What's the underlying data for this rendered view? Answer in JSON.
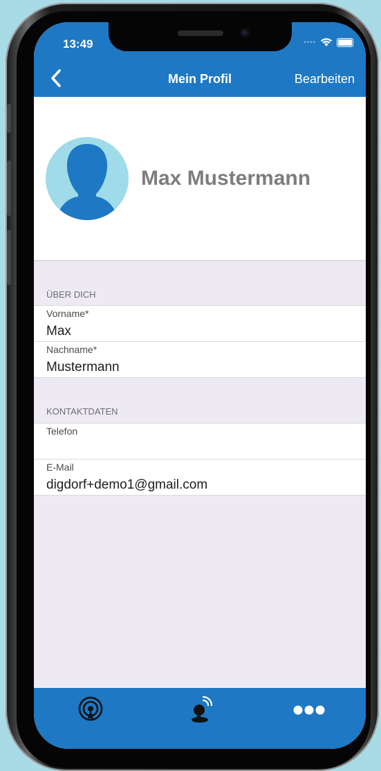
{
  "status_bar": {
    "time": "13:49"
  },
  "nav": {
    "title": "Mein Profil",
    "edit_label": "Bearbeiten"
  },
  "profile": {
    "name": "Max Mustermann"
  },
  "sections": [
    {
      "header": "ÜBER DICH",
      "fields": [
        {
          "label": "Vorname*",
          "value": "Max"
        },
        {
          "label": "Nachname*",
          "value": "Mustermann"
        }
      ]
    },
    {
      "header": "KONTAKTDATEN",
      "fields": [
        {
          "label": "Telefon",
          "value": ""
        },
        {
          "label": "E-Mail",
          "value": "digdorf+demo1@gmail.com"
        }
      ]
    }
  ],
  "tabbar": {
    "tabs": [
      {
        "icon": "broadcast-icon"
      },
      {
        "icon": "person-signal-icon"
      },
      {
        "icon": "more-dots-icon"
      }
    ]
  },
  "colors": {
    "accent": "#1e78c3",
    "avatar_bg": "#9fdbe9",
    "background": "#a9dbe6"
  }
}
